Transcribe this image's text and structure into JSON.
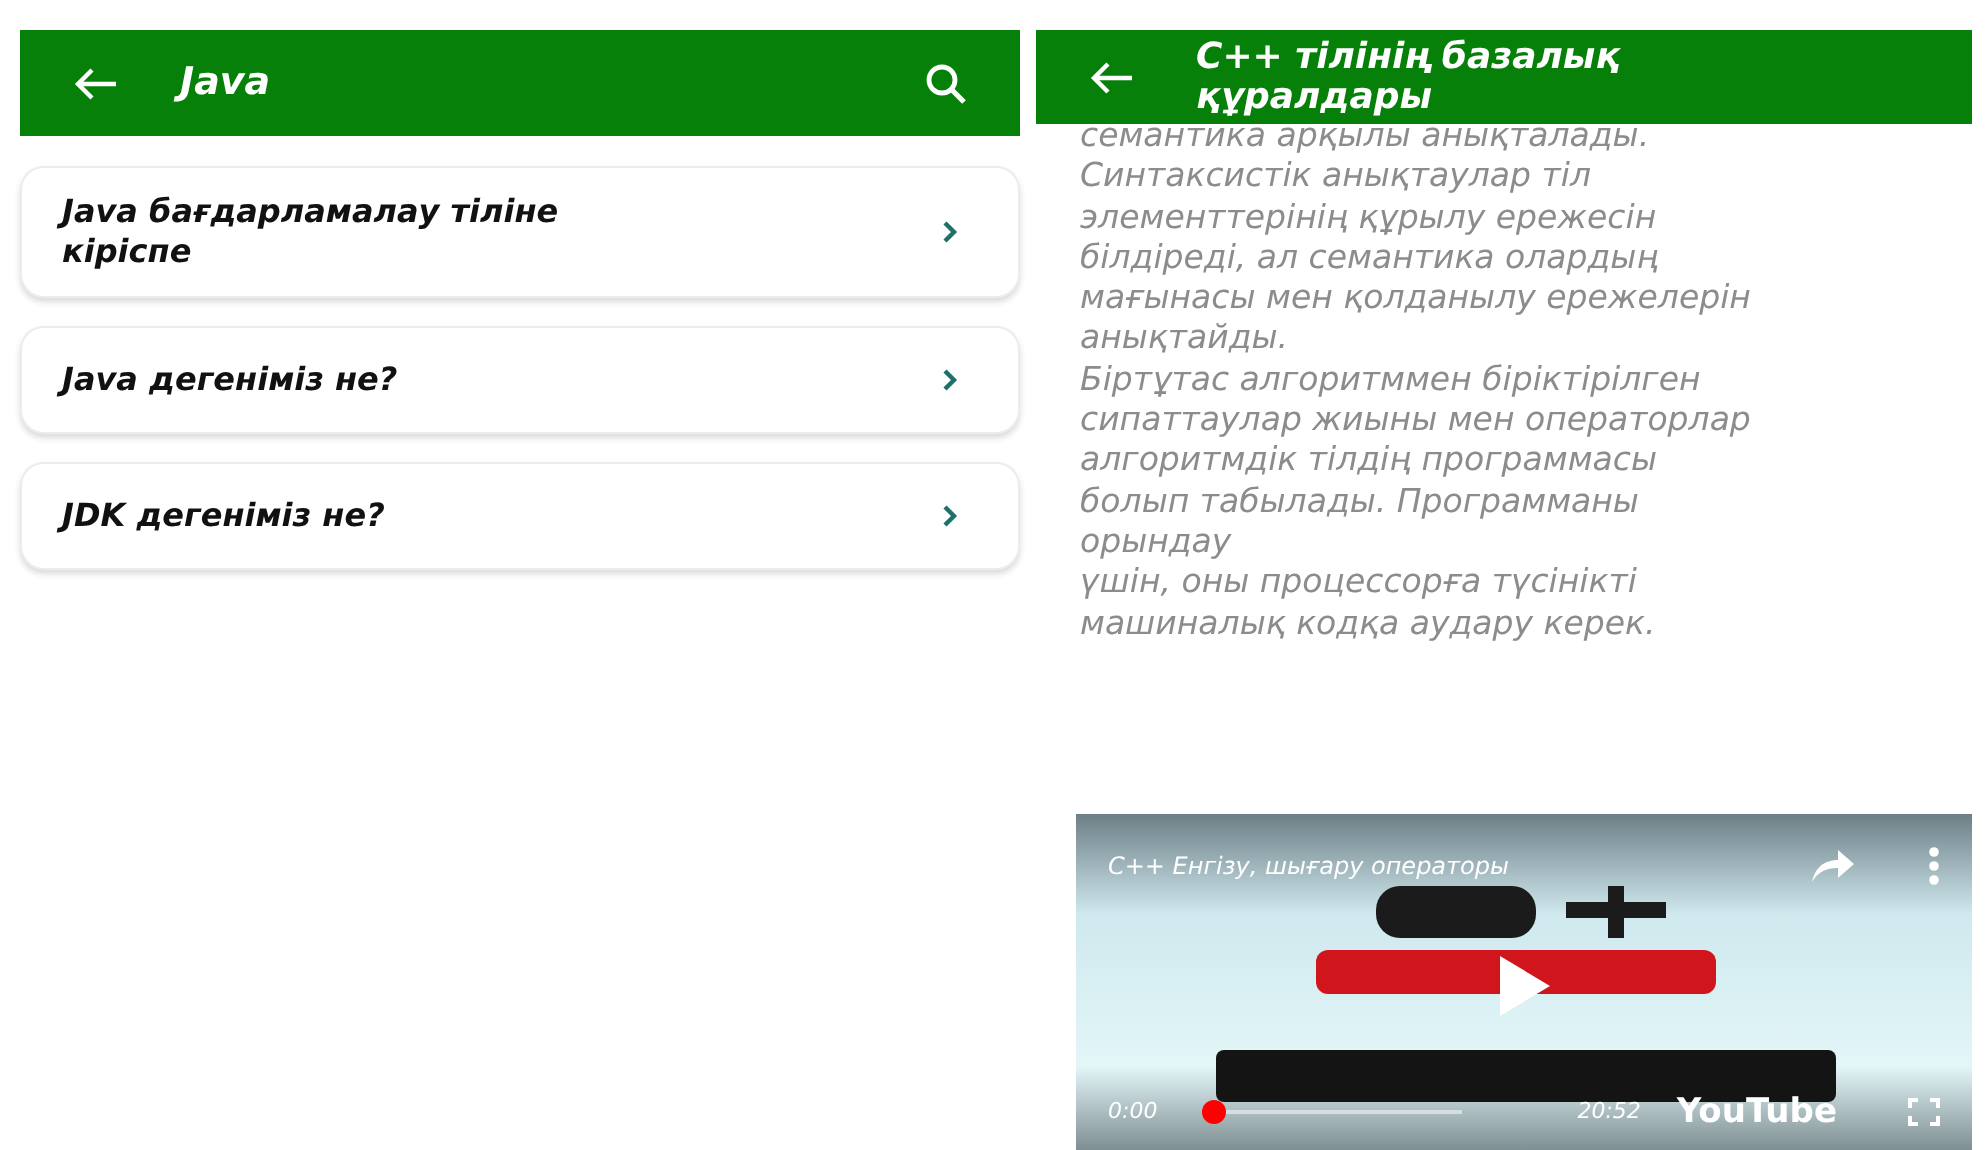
{
  "left_screen": {
    "header": {
      "title": "Java"
    },
    "items": [
      {
        "label": "Java бағдарламалау тіліне кіріспе"
      },
      {
        "label": "Java дегеніміз не?"
      },
      {
        "label": "JDK дегеніміз не?"
      }
    ]
  },
  "right_screen": {
    "header": {
      "title": "С++ тілінің базалық құралдары"
    },
    "lines": [
      "семантика арқылы анықталады.",
      "Синтаксистік анықтаулар тіл",
      "элементтерінің құрылу ережесін",
      "білдіреді, ал семантика олардың",
      "мағынасы мен қолданылу ережелерін",
      "анықтайды.",
      "Біртұтас алгоритммен біріктірілген",
      "сипаттаулар жиыны мен операторлар",
      "алгоритмдік тілдің программасы",
      "болып табылады. Программаны",
      "орындау",
      "үшін, оны процессорға түсінікті",
      "машиналық кодқа аудару керек."
    ],
    "video": {
      "title": "C++ Енгізу, шығару операторы",
      "elapsed": "0:00",
      "duration": "20:52",
      "brand": "YouTube",
      "progress": {
        "level": 0.02
      }
    }
  }
}
